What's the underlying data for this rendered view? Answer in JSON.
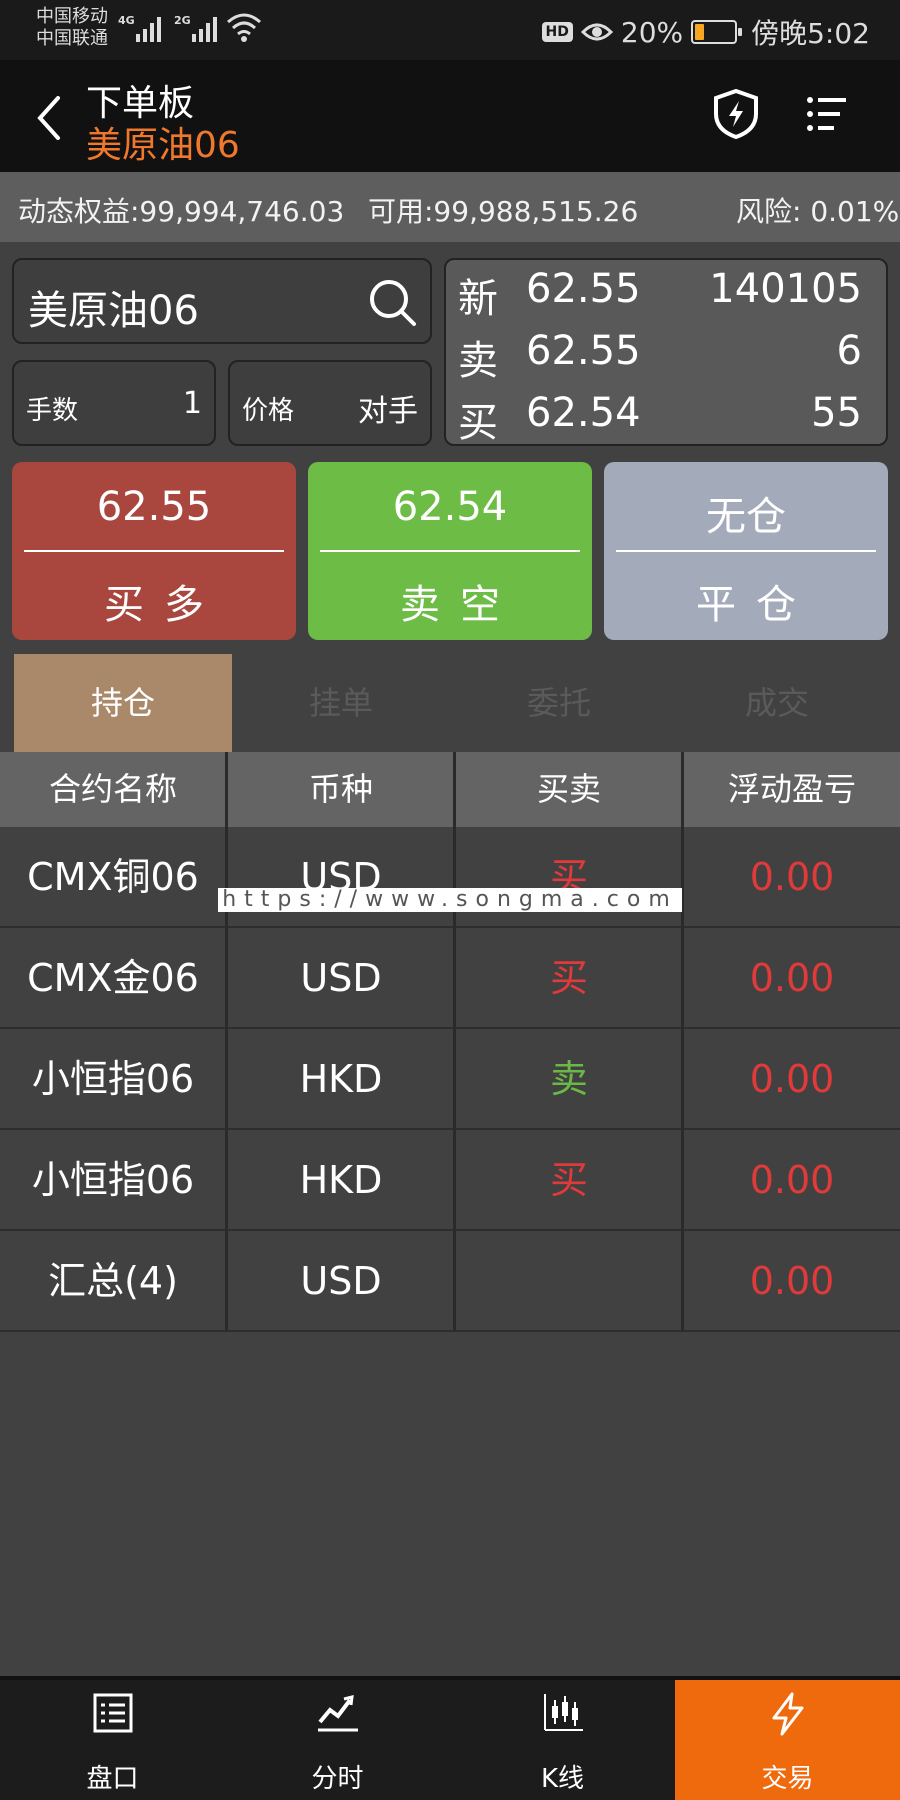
{
  "status_bar": {
    "carrier_1": "中国移动",
    "carrier_2": "中国联通",
    "sim1_network": "4G",
    "sim2_network": "2G",
    "hd_badge": "HD",
    "battery": "20%",
    "time": "傍晚5:02"
  },
  "header": {
    "title": "下单板",
    "subtitle": "美原油06",
    "subtitle_color": "#f0782d"
  },
  "account": {
    "equity": "动态权益:99,994,746.03",
    "available": "可用:99,988,515.26",
    "risk": "风险: 0.01%"
  },
  "order": {
    "contract": "美原油06",
    "lots_label": "手数",
    "lots_value": "1",
    "price_label": "价格",
    "price_value": "对手"
  },
  "quote": {
    "last_label": "新",
    "last_price": "62.55",
    "volume": "140105",
    "ask_label": "卖",
    "ask_price": "62.55",
    "ask_size": "6",
    "bid_label": "买",
    "bid_price": "62.54",
    "bid_size": "55"
  },
  "trade_buttons": {
    "buy_price": "62.55",
    "buy_label": "买多",
    "buy_color": "#a9463e",
    "sell_price": "62.54",
    "sell_label": "卖空",
    "sell_color": "#6cbc45",
    "close_status": "无仓",
    "close_label": "平仓",
    "close_color": "#a3aab9"
  },
  "tabs": [
    "持仓",
    "挂单",
    "委托",
    "成交"
  ],
  "table": {
    "headers": [
      "合约名称",
      "币种",
      "买卖",
      "浮动盈亏"
    ],
    "rows": [
      {
        "name": "CMX铜06",
        "currency": "USD",
        "side": "买",
        "pnl": "0.00"
      },
      {
        "name": "CMX金06",
        "currency": "USD",
        "side": "买",
        "pnl": "0.00"
      },
      {
        "name": "小恒指06",
        "currency": "HKD",
        "side": "卖",
        "pnl": "0.00"
      },
      {
        "name": "小恒指06",
        "currency": "HKD",
        "side": "买",
        "pnl": "0.00"
      },
      {
        "name": "汇总(4)",
        "currency": "USD",
        "side": "",
        "pnl": "0.00"
      }
    ]
  },
  "watermark": "https://www.songma.com",
  "bottom_nav": [
    {
      "label": "盘口",
      "icon": "orderbook-icon"
    },
    {
      "label": "分时",
      "icon": "timeshare-chart-icon"
    },
    {
      "label": "K线",
      "icon": "candlestick-icon"
    },
    {
      "label": "交易",
      "icon": "lightning-icon"
    }
  ],
  "colors": {
    "buy_red": "#e03a3a",
    "sell_green": "#6ab845",
    "active_tab": "#a9896a",
    "active_nav": "#ee6a0d"
  }
}
